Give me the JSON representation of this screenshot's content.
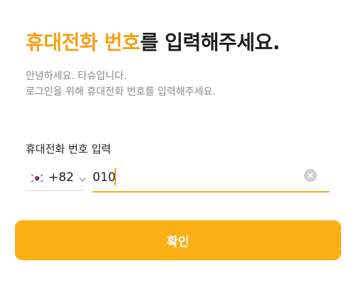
{
  "header": {
    "title_highlight": "휴대전화 번호",
    "title_rest": "를 입력해주세요."
  },
  "intro": {
    "line1": "안녕하세요. 타슈입니다.",
    "line2": "로그인을 위해 휴대전화 번호를 입력해주세요."
  },
  "form": {
    "phone_label": "휴대전화 번호 입력",
    "country_code": "+82",
    "country_flag_icon": "south-korea-flag-icon",
    "phone_value": "010"
  },
  "actions": {
    "confirm_label": "확인"
  },
  "colors": {
    "accent": "#f2a21a",
    "button": "#fbb016"
  }
}
